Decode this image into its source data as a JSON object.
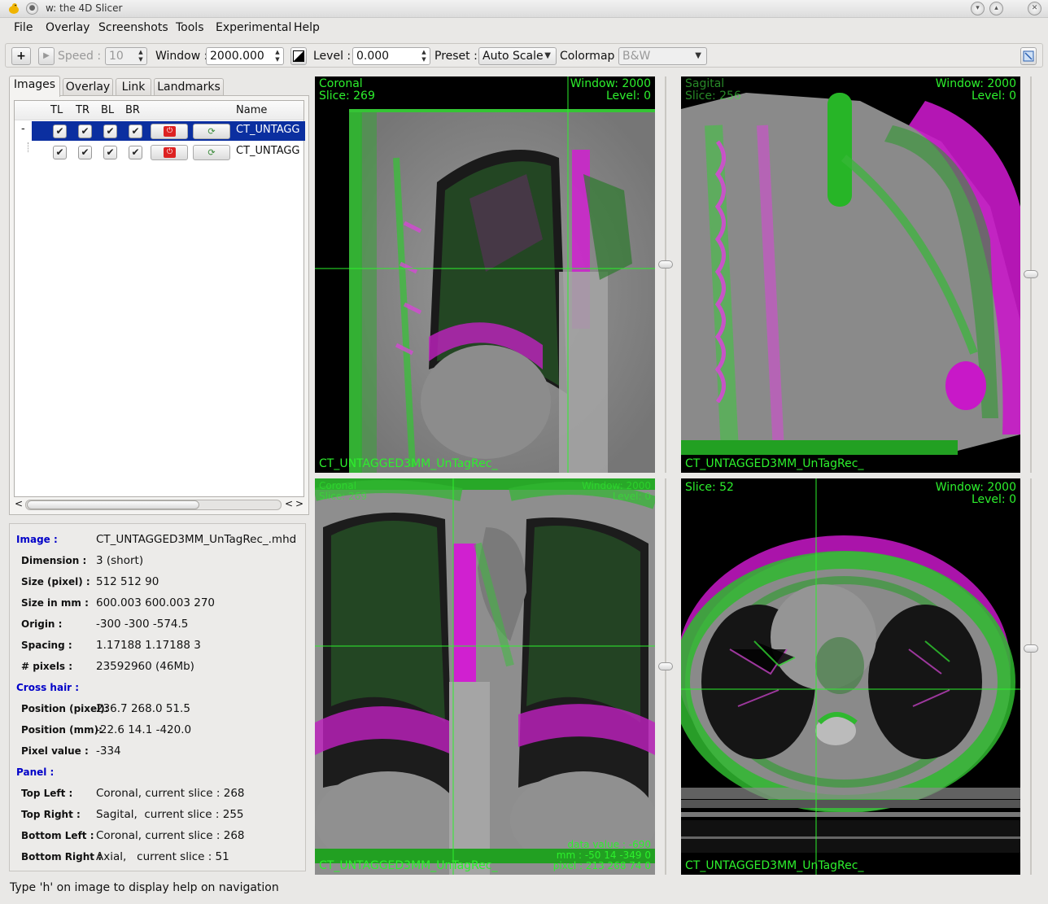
{
  "window": {
    "title": "w: the 4D Slicer"
  },
  "menu": [
    "File",
    "Overlay",
    "Screenshots",
    "Tools",
    "Experimental",
    "Help"
  ],
  "toolbar": {
    "add_label": "+",
    "speed_label": "Speed :",
    "speed_value": "10",
    "window_label": "Window :",
    "window_value": "2000.000",
    "level_label": "Level :",
    "level_value": "0.000",
    "preset_label": "Preset :",
    "preset_value": "Auto Scale",
    "colormap_label": "Colormap :",
    "colormap_value": "B&W"
  },
  "tabs": [
    "Images",
    "Overlay",
    "Link",
    "Landmarks"
  ],
  "tree": {
    "headers": [
      "TL",
      "TR",
      "BL",
      "BR",
      "",
      "",
      "Name"
    ],
    "rows": [
      {
        "expander": "-",
        "name": "CT_UNTAGG",
        "selected": true
      },
      {
        "expander": "",
        "name": "CT_UNTAGG",
        "selected": false
      }
    ]
  },
  "info": [
    {
      "key": "Image :",
      "value": "CT_UNTAGGED3MM_UnTagRec_.mhd",
      "section": true
    },
    {
      "key": "Dimension :",
      "value": "3 (short)"
    },
    {
      "key": "Size (pixel) :",
      "value": "512 512 90"
    },
    {
      "key": "Size in mm :",
      "value": "600.003 600.003 270"
    },
    {
      "key": "Origin :",
      "value": "-300 -300 -574.5"
    },
    {
      "key": "Spacing :",
      "value": "1.17188 1.17188 3"
    },
    {
      "key": "# pixels :",
      "value": "23592960 (46Mb)"
    },
    {
      "key": "Cross hair :",
      "value": "",
      "section": true
    },
    {
      "key": "Position (pixel):",
      "value": "236.7 268.0 51.5"
    },
    {
      "key": "Position (mm):",
      "value": "-22.6 14.1 -420.0"
    },
    {
      "key": "Pixel value :",
      "value": "-334"
    },
    {
      "key": "Panel :",
      "value": "",
      "section": true
    },
    {
      "key": "Top Left :",
      "value": "Coronal, current slice : 268"
    },
    {
      "key": "Top Right :",
      "value": "Sagital,  current slice : 255"
    },
    {
      "key": "Bottom Left :",
      "value": "Coronal, current slice : 268"
    },
    {
      "key": "Bottom Right :",
      "value": "Axial,   current slice : 51"
    }
  ],
  "status": "Type 'h' on image to display help on navigation",
  "views": {
    "tl": {
      "orientation": "Coronal",
      "slice": "Slice: 269",
      "window": "Window: 2000",
      "level": "Level: 0",
      "filename": "CT_UNTAGGED3MM_UnTagRec_"
    },
    "tr": {
      "orientation": "Sagital",
      "slice": "Slice: 256",
      "window": "Window: 2000",
      "level": "Level: 0",
      "filename": "CT_UNTAGGED3MM_UnTagRec_"
    },
    "bl": {
      "orientation": "Coronal",
      "slice": "Slice: 269",
      "window": "Window: 2000",
      "level": "Level: 0",
      "filename": "CT_UNTAGGED3MM_UnTagRec_",
      "data_value": "data value : -690",
      "mm": "mm : -50 14 -349 0",
      "pixel": "pixel : 213 268 74 0"
    },
    "br": {
      "slice": "Slice: 52",
      "window": "Window: 2000",
      "level": "Level: 0",
      "filename": "CT_UNTAGGED3MM_UnTagRec_"
    }
  },
  "colors": {
    "overlay_green": "#2df02d",
    "overlay_magenta": "#e020e0",
    "selection": "#0b2fa0",
    "section_blue": "#0000c8"
  }
}
